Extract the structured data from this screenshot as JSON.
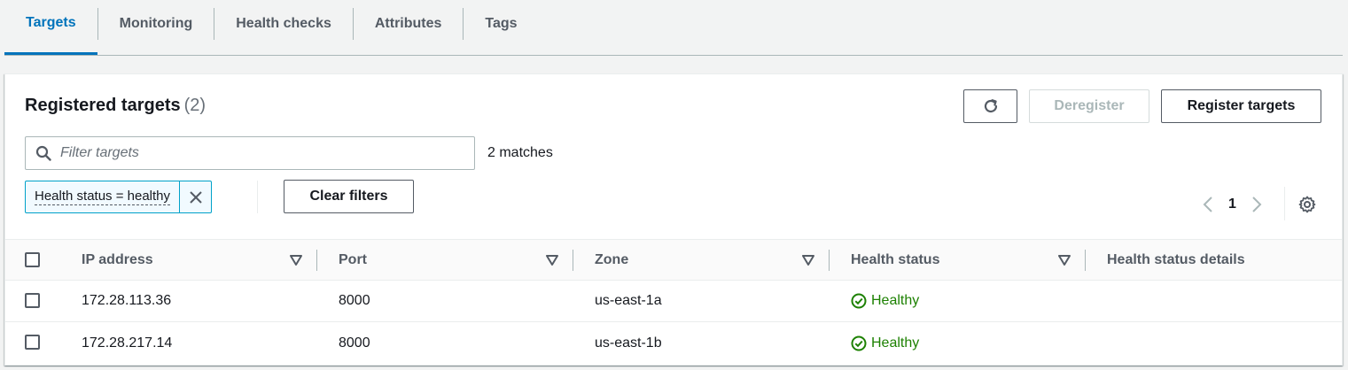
{
  "tabs": [
    {
      "label": "Targets",
      "active": true
    },
    {
      "label": "Monitoring"
    },
    {
      "label": "Health checks"
    },
    {
      "label": "Attributes"
    },
    {
      "label": "Tags"
    }
  ],
  "panel": {
    "title": "Registered targets",
    "count": "(2)",
    "deregister_label": "Deregister",
    "register_label": "Register targets",
    "refresh_icon": "refresh-icon"
  },
  "filter": {
    "placeholder": "Filter targets",
    "value": "",
    "matches": "2 matches",
    "token": "Health status = healthy",
    "clear_label": "Clear filters"
  },
  "pagination": {
    "page": "1"
  },
  "table": {
    "columns": [
      "IP address",
      "Port",
      "Zone",
      "Health status",
      "Health status details"
    ],
    "rows": [
      {
        "ip": "172.28.113.36",
        "port": "8000",
        "zone": "us-east-1a",
        "health": "Healthy",
        "details": ""
      },
      {
        "ip": "172.28.217.14",
        "port": "8000",
        "zone": "us-east-1b",
        "health": "Healthy",
        "details": ""
      }
    ]
  },
  "colors": {
    "accent": "#0073bb",
    "healthy": "#1d8102",
    "token_border": "#00a1c9"
  }
}
